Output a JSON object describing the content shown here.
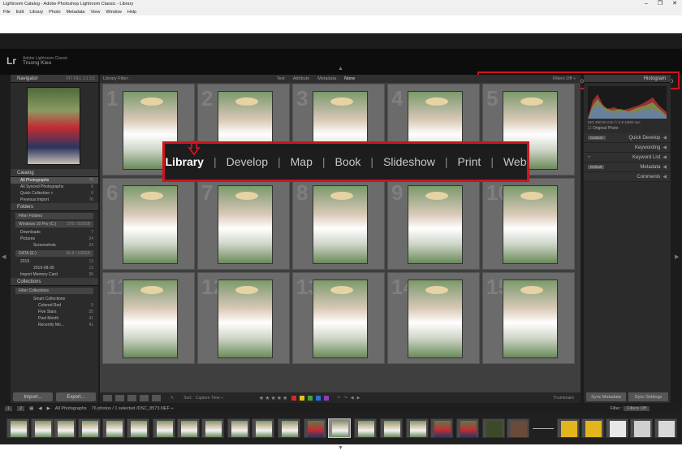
{
  "window": {
    "title": "Lightroom Catalog - Adobe Photoshop Lightroom Classic - Library",
    "controls": [
      "–",
      "❐",
      "✕"
    ]
  },
  "menu": [
    "File",
    "Edit",
    "Library",
    "Photo",
    "Metadata",
    "View",
    "Window",
    "Help"
  ],
  "identity": {
    "logo": "Lr",
    "app_line": "Adobe Lightroom Classic",
    "user_name": "Truong Kieu"
  },
  "modules": [
    "Library",
    "Develop",
    "Map",
    "Book",
    "Slideshow",
    "Print",
    "Web"
  ],
  "active_module": "Library",
  "left_panel": {
    "navigator": {
      "title": "Navigator",
      "zoom_options": "FIT  FILL  1:1  3:1"
    },
    "catalog": {
      "title": "Catalog",
      "items": [
        {
          "label": "All Photographs",
          "count": "76",
          "selected": true
        },
        {
          "label": "All Synced Photographs",
          "count": "0"
        },
        {
          "label": "Quick Collection +",
          "count": "0"
        },
        {
          "label": "Previous Import",
          "count": "76"
        }
      ]
    },
    "folders": {
      "title": "Folders",
      "filter_placeholder": "Filter Folders",
      "volumes": [
        {
          "name": "Windows 10 Pro (C:)",
          "size": "375 / 500GB",
          "items": [
            {
              "label": "Downloads",
              "count": "7",
              "level": 1
            },
            {
              "label": "Pictures",
              "count": "24",
              "level": 1
            },
            {
              "label": "Screenshots",
              "count": "24",
              "level": 2
            }
          ]
        },
        {
          "name": "DATA (E:)",
          "size": "36.8 / 100GB",
          "items": [
            {
              "label": "2019",
              "count": "13",
              "level": 1
            },
            {
              "label": "2019-08-30",
              "count": "13",
              "level": 2
            },
            {
              "label": "Import Memory Card",
              "count": "36",
              "level": 1
            }
          ]
        }
      ]
    },
    "collections": {
      "title": "Collections",
      "filter_placeholder": "Filter Collections",
      "items": [
        {
          "label": "Smart Collections",
          "count": "",
          "level": 1
        },
        {
          "label": "Colored Red",
          "count": "0",
          "level": 2
        },
        {
          "label": "Five Stars",
          "count": "25",
          "level": 2
        },
        {
          "label": "Past Month",
          "count": "41",
          "level": 2
        },
        {
          "label": "Recently Mo...",
          "count": "41",
          "level": 2
        }
      ]
    },
    "import_label": "Import...",
    "export_label": "Export..."
  },
  "library_filter": {
    "title": "Library Filter :",
    "options": [
      "Text",
      "Attribute",
      "Metadata",
      "None"
    ],
    "active": "None",
    "filters_off": "Filters Off ÷"
  },
  "grid": {
    "cell_numbers": [
      "1",
      "2",
      "3",
      "4",
      "5",
      "6",
      "7",
      "8",
      "9",
      "10",
      "11",
      "12",
      "13",
      "14",
      "15"
    ]
  },
  "toolbar": {
    "sort_label": "Sort:",
    "sort_value": "Capture Time ÷",
    "stars": "★★★★★",
    "label_colors": [
      "#d12b2b",
      "#e1c11d",
      "#3fa33a",
      "#2a6fd1",
      "#8c3fb5"
    ],
    "thumbnails_label": "Thumbnails"
  },
  "right_panel": {
    "histogram_title": "Histogram",
    "histogram_info": "ISO 200   50 mm   f / 2.8   1/800 sec",
    "original_photo": "Original Photo",
    "sections": [
      {
        "preset": "Custom",
        "label": "Quick Develop"
      },
      {
        "preset": "",
        "label": "Keywording"
      },
      {
        "preset": "",
        "label": "Keyword List"
      },
      {
        "preset": "Default",
        "label": "Metadata"
      },
      {
        "preset": "",
        "label": "Comments"
      }
    ],
    "sync_metadata": "Sync Metadata",
    "sync_settings": "Sync Settings"
  },
  "filmstrip_bar": {
    "pages": [
      "1",
      "2"
    ],
    "source": "All Photographs",
    "info": "76 photos / 1 selected /DSC_8573.NEF ÷",
    "filter_label": "Filter :",
    "filter_value": "Filters Off"
  }
}
